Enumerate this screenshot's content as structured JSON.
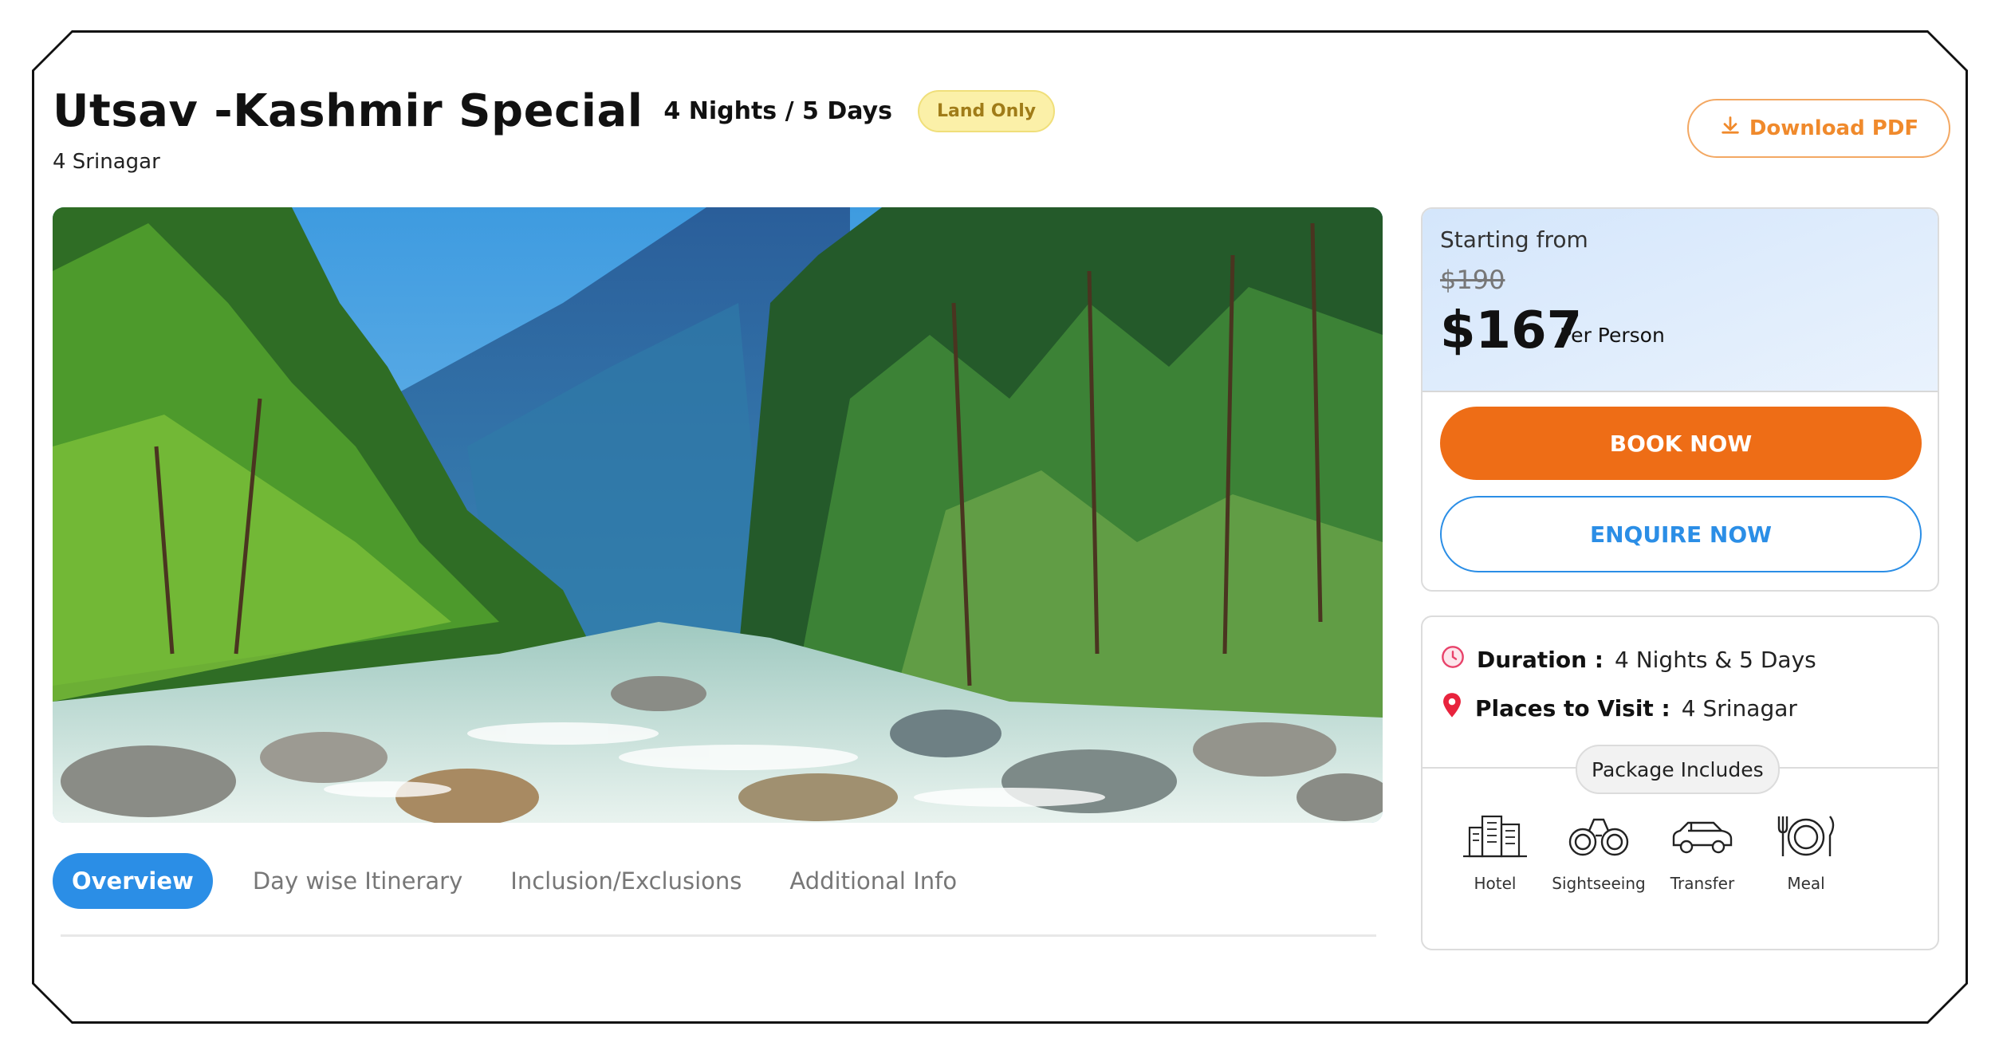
{
  "package": {
    "title": "Utsav -Kashmir Special",
    "duration_heading": "4 Nights / 5 Days",
    "badge": "Land Only",
    "subtitle": "4 Srinagar"
  },
  "actions": {
    "download_label": "Download PDF",
    "book_label": "BOOK NOW",
    "enquire_label": "ENQUIRE NOW"
  },
  "pricing": {
    "starting_label": "Starting from",
    "old_price": "$190",
    "price": "$167",
    "per_label": "Per Person"
  },
  "tabs": [
    {
      "label": "Overview",
      "active": true
    },
    {
      "label": "Day wise Itinerary",
      "active": false
    },
    {
      "label": "Inclusion/Exclusions",
      "active": false
    },
    {
      "label": "Additional Info",
      "active": false
    }
  ],
  "details": {
    "duration_key": "Duration :",
    "duration_value": "4 Nights & 5 Days",
    "places_key": "Places to Visit :",
    "places_value": "4 Srinagar",
    "includes_label": "Package Includes",
    "amenities": [
      {
        "label": "Hotel",
        "icon": "hotel-icon"
      },
      {
        "label": "Sightseeing",
        "icon": "binoculars-icon"
      },
      {
        "label": "Transfer",
        "icon": "car-icon"
      },
      {
        "label": "Meal",
        "icon": "meal-icon"
      }
    ]
  },
  "colors": {
    "accent_blue": "#2b8ee6",
    "book_orange": "#ee6d16",
    "download_orange": "#f08a2c",
    "badge_yellow": "#fbf0a8"
  }
}
